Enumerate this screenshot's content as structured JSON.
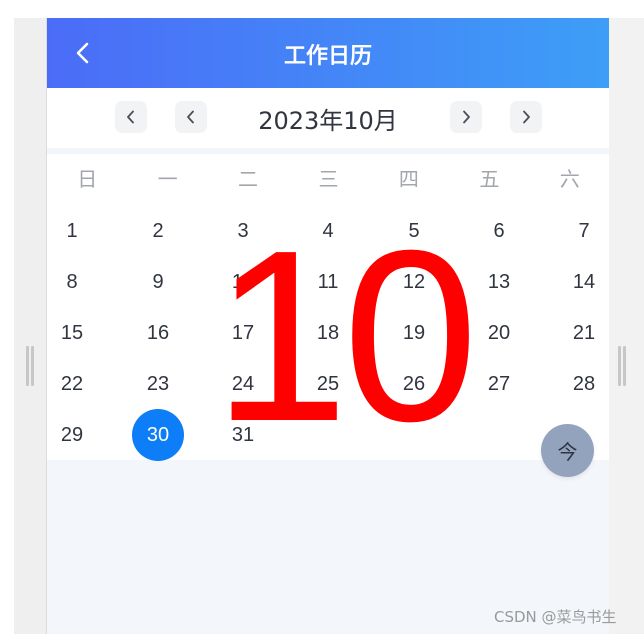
{
  "header": {
    "title": "工作日历",
    "back_icon": "chevron-left-icon"
  },
  "month_bar": {
    "title": "2023年10月",
    "prev_year_icon": "chevron-left-icon",
    "prev_month_icon": "chevron-left-icon",
    "next_month_icon": "chevron-right-icon",
    "next_year_icon": "chevron-right-icon"
  },
  "weekdays": [
    "日",
    "一",
    "二",
    "三",
    "四",
    "五",
    "六"
  ],
  "days": [
    [
      "1",
      "2",
      "3",
      "4",
      "5",
      "6",
      "7"
    ],
    [
      "8",
      "9",
      "10",
      "11",
      "12",
      "13",
      "14"
    ],
    [
      "15",
      "16",
      "17",
      "18",
      "19",
      "20",
      "21"
    ],
    [
      "22",
      "23",
      "24",
      "25",
      "26",
      "27",
      "28"
    ],
    [
      "29",
      "30",
      "31"
    ]
  ],
  "selected_day": "30",
  "watermark_month": "10",
  "today_button": "今",
  "credit": "CSDN @菜鸟书生",
  "colors": {
    "header_start": "#4b6cf7",
    "header_end": "#3d9ef7",
    "selected": "#0e7ef8",
    "watermark": "#ff0000",
    "today_button": "#94a3bd"
  }
}
